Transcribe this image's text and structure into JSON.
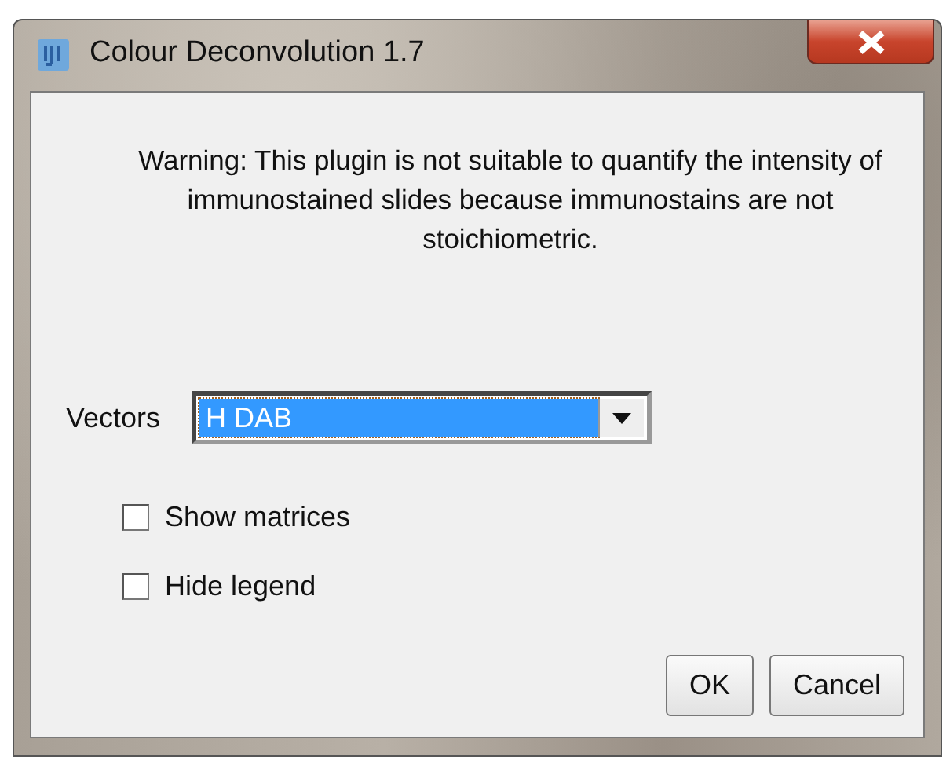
{
  "window": {
    "title": "Colour Deconvolution 1.7"
  },
  "warning": "Warning: This plugin is not suitable to quantify the intensity of immunostained slides because immunostains are not stoichiometric.",
  "vectors": {
    "label": "Vectors",
    "value": "H DAB"
  },
  "checkboxes": [
    {
      "label": "Show matrices",
      "checked": false
    },
    {
      "label": "Hide legend",
      "checked": false
    }
  ],
  "buttons": [
    {
      "label": "OK"
    },
    {
      "label": "Cancel"
    }
  ]
}
